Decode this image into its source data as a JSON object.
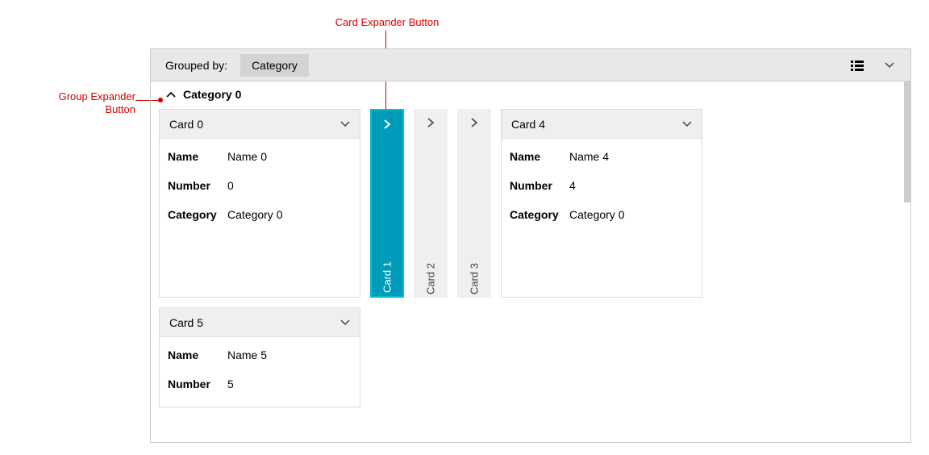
{
  "annotations": {
    "card_expander": "Card Expander Button",
    "group_expander_l1": "Group Expander",
    "group_expander_l2": "Button"
  },
  "toolbar": {
    "grouped_by_label": "Grouped by:",
    "group_field": "Category"
  },
  "group": {
    "title": "Category 0"
  },
  "cards": {
    "expanded": [
      {
        "title": "Card 0",
        "fields": [
          {
            "label": "Name",
            "value": "Name 0"
          },
          {
            "label": "Number",
            "value": "0"
          },
          {
            "label": "Category",
            "value": "Category 0"
          }
        ]
      },
      {
        "title": "Card 4",
        "fields": [
          {
            "label": "Name",
            "value": "Name 4"
          },
          {
            "label": "Number",
            "value": "4"
          },
          {
            "label": "Category",
            "value": "Category 0"
          }
        ]
      },
      {
        "title": "Card 5",
        "fields": [
          {
            "label": "Name",
            "value": "Name 5"
          },
          {
            "label": "Number",
            "value": "5"
          }
        ]
      }
    ],
    "collapsed": [
      {
        "title": "Card 1",
        "selected": true
      },
      {
        "title": "Card 2",
        "selected": false
      },
      {
        "title": "Card 3",
        "selected": false
      }
    ]
  }
}
